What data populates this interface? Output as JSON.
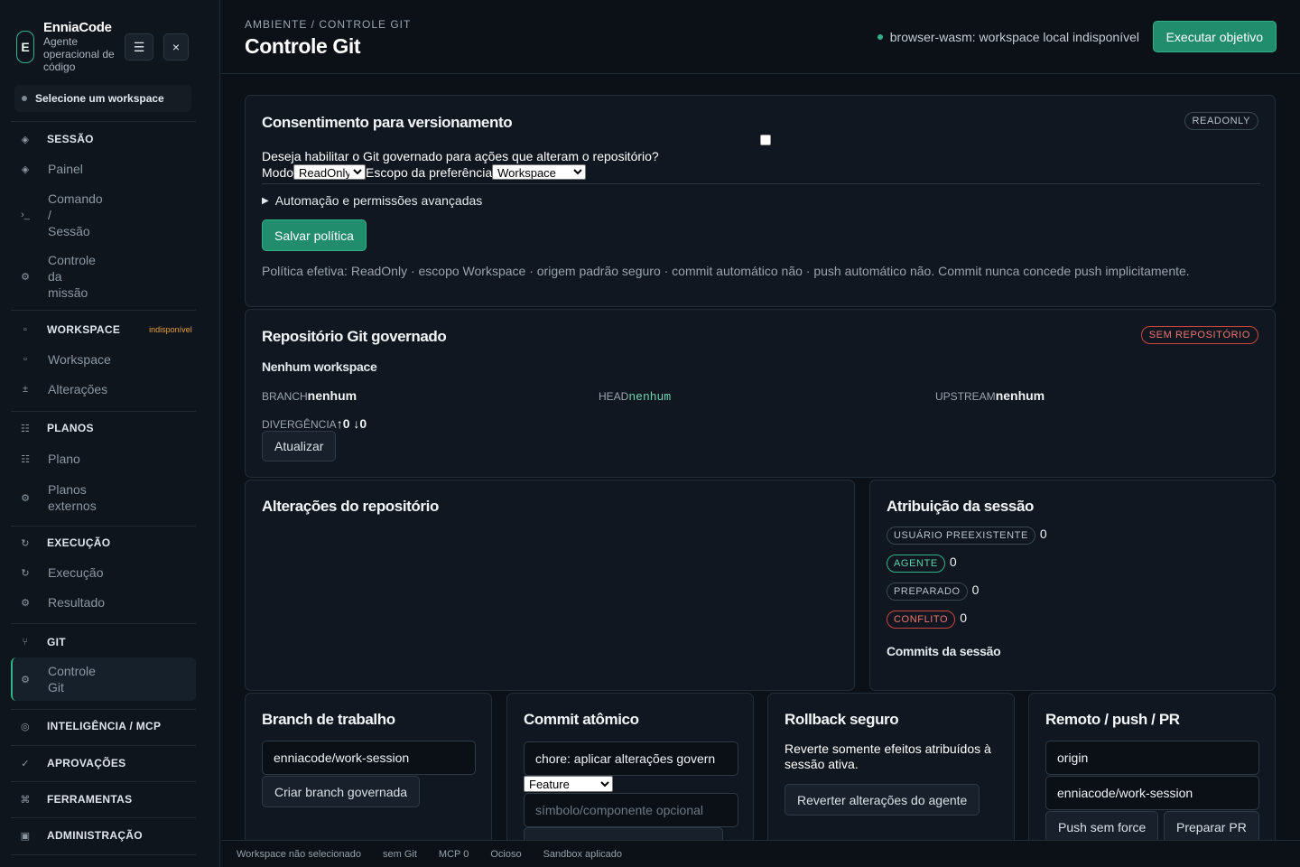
{
  "brand": {
    "name": "EnniaCode",
    "logo_letter": "E",
    "subtitle": "Agente operacional de código"
  },
  "sidebar": {
    "menu_icon": "☰",
    "close_icon": "×",
    "workspace_select": "Selecione um workspace",
    "sections": {
      "sessao": "SESSÃO",
      "workspace": "WORKSPACE",
      "workspace_tag": "indisponível",
      "planos": "PLANOS",
      "execucao": "EXECUÇÃO",
      "git": "GIT",
      "inteligencia": "INTELIGÊNCIA / MCP",
      "aprovacoes": "APROVAÇÕES",
      "ferramentas": "FERRAMENTAS",
      "administracao": "ADMINISTRAÇÃO"
    },
    "items": {
      "painel": "Painel",
      "comando_1": "Comando",
      "comando_2": "/",
      "comando_3": "Sessão",
      "controle_missao_1": "Controle",
      "controle_missao_2": "da",
      "controle_missao_3": "missão",
      "workspace": "Workspace",
      "alteracoes": "Alterações",
      "plano": "Plano",
      "planos_externos_1": "Planos",
      "planos_externos_2": "externos",
      "execucao": "Execução",
      "resultado": "Resultado",
      "controle_git_1": "Controle",
      "controle_git_2": "Git"
    }
  },
  "header": {
    "breadcrumb": "AMBIENTE / CONTROLE GIT",
    "title": "Controle Git",
    "status": "browser-wasm: workspace local indisponível",
    "run_button": "Executar objetivo"
  },
  "consent": {
    "title": "Consentimento para versionamento",
    "badge": "READONLY",
    "question": "Deseja habilitar o Git governado para ações que alteram o repositório?",
    "mode_label": "Modo",
    "mode_value": "ReadOnly",
    "scope_label": "Escopo da preferência",
    "scope_value": "Workspace",
    "advanced": "Automação e permissões avançadas",
    "save_button": "Salvar política",
    "effective": "Política efetiva: ReadOnly · escopo Workspace · origem padrão seguro · commit automático não · push automático não. Commit nunca concede push implicitamente."
  },
  "repo": {
    "title": "Repositório Git governado",
    "badge": "SEM REPOSITÓRIO",
    "workspace": "Nenhum workspace",
    "branch_label": "BRANCH",
    "branch_value": "nenhum",
    "head_label": "HEAD",
    "head_value": "nenhum",
    "upstream_label": "UPSTREAM",
    "upstream_value": "nenhum",
    "divergence_label": "DIVERGÊNCIA",
    "divergence_value": "↑0 ↓0",
    "refresh_button": "Atualizar"
  },
  "changes": {
    "title": "Alterações do repositório"
  },
  "attribution": {
    "title": "Atribuição da sessão",
    "rows": [
      {
        "label": "USUÁRIO PREEXISTENTE",
        "count": "0"
      },
      {
        "label": "AGENTE",
        "count": "0"
      },
      {
        "label": "PREPARADO",
        "count": "0"
      },
      {
        "label": "CONFLITO",
        "count": "0"
      }
    ],
    "commits_title": "Commits da sessão"
  },
  "branch": {
    "title": "Branch de trabalho",
    "input_value": "enniacode/work-session",
    "create_button": "Criar branch governada"
  },
  "commit": {
    "title": "Commit atômico",
    "message_value": "chore: aplicar alterações govern",
    "type_value": "Feature",
    "symbol_placeholder": "símbolo/componente opcional"
  },
  "rollback": {
    "title": "Rollback seguro",
    "description": "Reverte somente efeitos atribuídos à sessão ativa.",
    "revert_button": "Reverter alterações do agente"
  },
  "remote": {
    "title": "Remoto / push / PR",
    "remote_value": "origin",
    "branch_value": "enniacode/work-session",
    "push_button": "Push sem force",
    "pr_button": "Preparar PR"
  },
  "footer": {
    "workspace": "Workspace não selecionado",
    "git": "sem Git",
    "mcp": "MCP 0",
    "state": "Ocioso",
    "sandbox": "Sandbox aplicado"
  },
  "colors": {
    "accent": "#2fb389",
    "background": "#0c1117",
    "panel": "#101720",
    "danger": "#f07570",
    "warning": "#e5a23c"
  },
  "icons": {
    "sessao": "diamond-icon",
    "painel": "diamond-icon",
    "comando": "terminal-icon",
    "controle": "gear-icon",
    "workspace": "square-icon",
    "alteracoes": "plus-minus-icon",
    "planos": "list-icon",
    "execucao": "refresh-icon",
    "resultado": "gear-icon",
    "git": "branch-icon",
    "inteligencia": "target-icon",
    "aprovacoes": "check-icon",
    "ferramentas": "command-icon",
    "administracao": "panel-icon"
  }
}
